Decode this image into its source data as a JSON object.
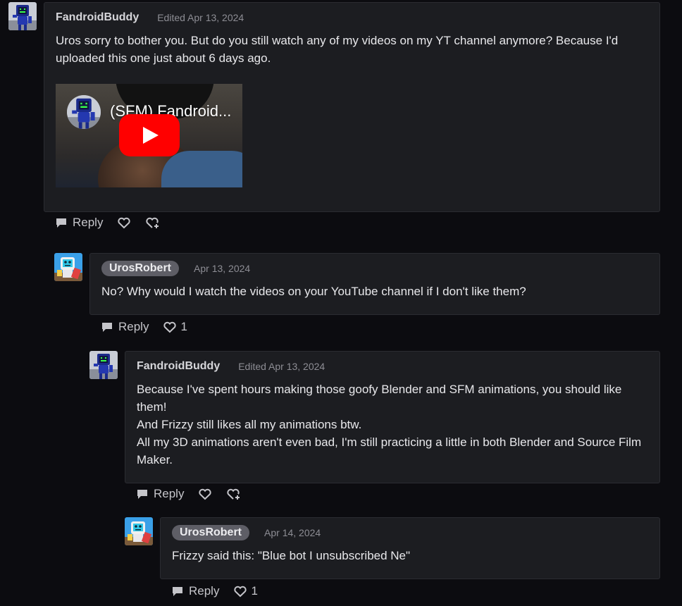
{
  "comments": [
    {
      "author": "FandroidBuddy",
      "date": "Edited Apr 13, 2024",
      "lines": [
        "Uros sorry to bother you. But do you still watch any of my videos on my YT channel anymore? Because I'd uploaded this one just about 6 days ago."
      ],
      "video": {
        "title": "(SFM) Fandroid..."
      },
      "actions": {
        "reply": "Reply"
      }
    },
    {
      "author": "UrosRobert",
      "date": "Apr 13, 2024",
      "lines": [
        "No? Why would I watch the videos on your YouTube channel if I don't like them?"
      ],
      "actions": {
        "reply": "Reply",
        "likes": "1"
      }
    },
    {
      "author": "FandroidBuddy",
      "date": "Edited Apr 13, 2024",
      "lines": [
        "Because I've spent hours making those goofy Blender and SFM animations, you should like them!",
        "And Frizzy still likes all my animations btw.",
        "All my 3D animations aren't even bad, I'm still practicing a little in both Blender and Source Film Maker."
      ],
      "actions": {
        "reply": "Reply"
      }
    },
    {
      "author": "UrosRobert",
      "date": "Apr 14, 2024",
      "lines": [
        "Frizzy said this: \"Blue bot I unsubscribed Ne\""
      ],
      "actions": {
        "reply": "Reply",
        "likes": "1"
      }
    }
  ],
  "icons": {
    "reply": "speech-bubble-icon",
    "like": "heart-icon",
    "award": "heart-plus-icon"
  },
  "colors": {
    "background": "#0c0c10",
    "card": "#1c1d21",
    "border": "#2b2c31",
    "pill": "#5e5e66",
    "youtube_red": "#ff0000"
  }
}
